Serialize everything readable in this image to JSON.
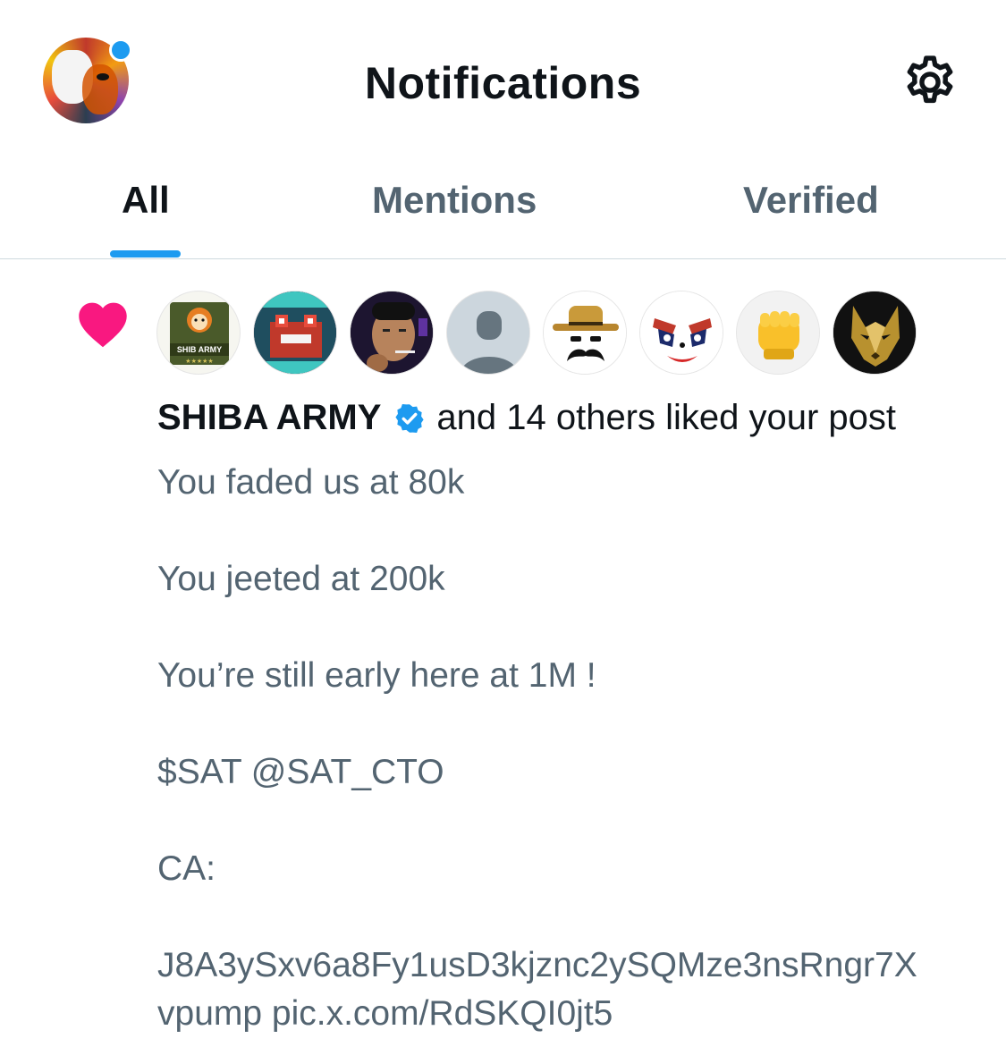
{
  "header": {
    "title": "Notifications",
    "has_unread_dot": true,
    "accent": "#1d9bf0"
  },
  "tabs": [
    {
      "label": "All",
      "active": true
    },
    {
      "label": "Mentions",
      "active": false
    },
    {
      "label": "Verified",
      "active": false
    }
  ],
  "notification": {
    "type": "like",
    "icon": "heart-icon",
    "icon_color": "#f91880",
    "avatars": [
      {
        "name": "shiba-army-avatar",
        "text": "SHIB ARMY"
      },
      {
        "name": "pixel-frog-avatar"
      },
      {
        "name": "smoking-man-avatar"
      },
      {
        "name": "default-avatar"
      },
      {
        "name": "hat-mustache-avatar"
      },
      {
        "name": "clown-face-avatar"
      },
      {
        "name": "raised-fist-avatar"
      },
      {
        "name": "gold-wolf-avatar"
      }
    ],
    "actor": "SHIBA ARMY",
    "actor_verified": true,
    "action_text": "and 14 others liked your post",
    "post_lines": [
      "You faded us at 80k",
      "",
      "You jeeted at 200k",
      "",
      "You’re still early here at 1M !",
      "",
      "$SAT @SAT_CTO",
      "",
      "CA:",
      "",
      "J8A3ySxv6a8Fy1usD3kjznc2ySQMze3nsRngr7X",
      "vpump pic.x.com/RdSKQI0jt5"
    ]
  }
}
